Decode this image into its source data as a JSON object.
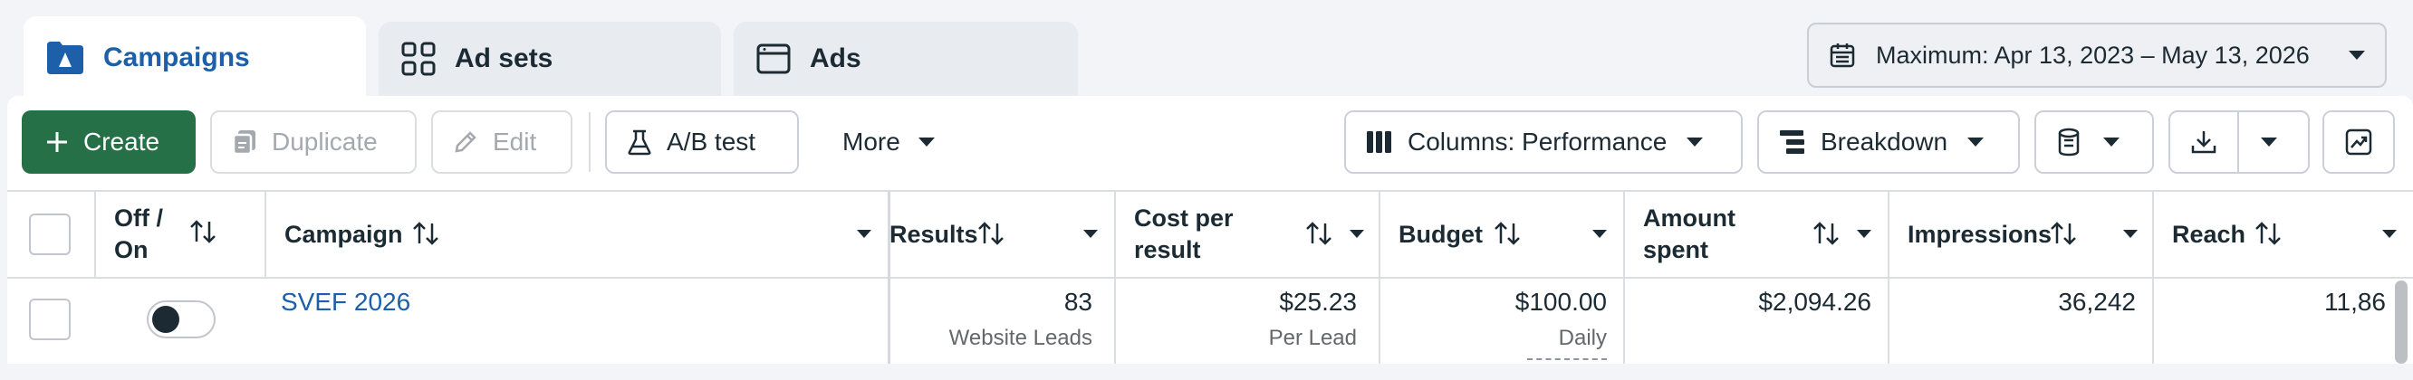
{
  "tabs": [
    {
      "label": "Campaigns",
      "active": true
    },
    {
      "label": "Ad sets",
      "active": false
    },
    {
      "label": "Ads",
      "active": false
    }
  ],
  "date_range": {
    "label": "Maximum: Apr 13, 2023 – May 13, 2026"
  },
  "toolbar": {
    "create": "Create",
    "duplicate": "Duplicate",
    "edit": "Edit",
    "ab_test": "A/B test",
    "more": "More",
    "columns": "Columns: Performance",
    "breakdown": "Breakdown"
  },
  "table": {
    "headers": {
      "off_on": "Off / On",
      "campaign": "Campaign",
      "results": "Results",
      "cost_per_result": "Cost per result",
      "budget": "Budget",
      "amount_spent": "Amount spent",
      "impressions": "Impressions",
      "reach": "Reach"
    },
    "rows": [
      {
        "campaign": "SVEF 2026",
        "toggle_on": false,
        "results": "83",
        "results_sub": "Website Leads",
        "cost_per_result": "$25.23",
        "cost_per_result_sub": "Per Lead",
        "budget": "$100.00",
        "budget_sub": "Daily",
        "amount_spent": "$2,094.26",
        "impressions": "36,242",
        "reach": "11,86"
      }
    ]
  },
  "colors": {
    "accent": "#1d5fa8",
    "create": "#267048",
    "link": "#1d5fa8"
  }
}
